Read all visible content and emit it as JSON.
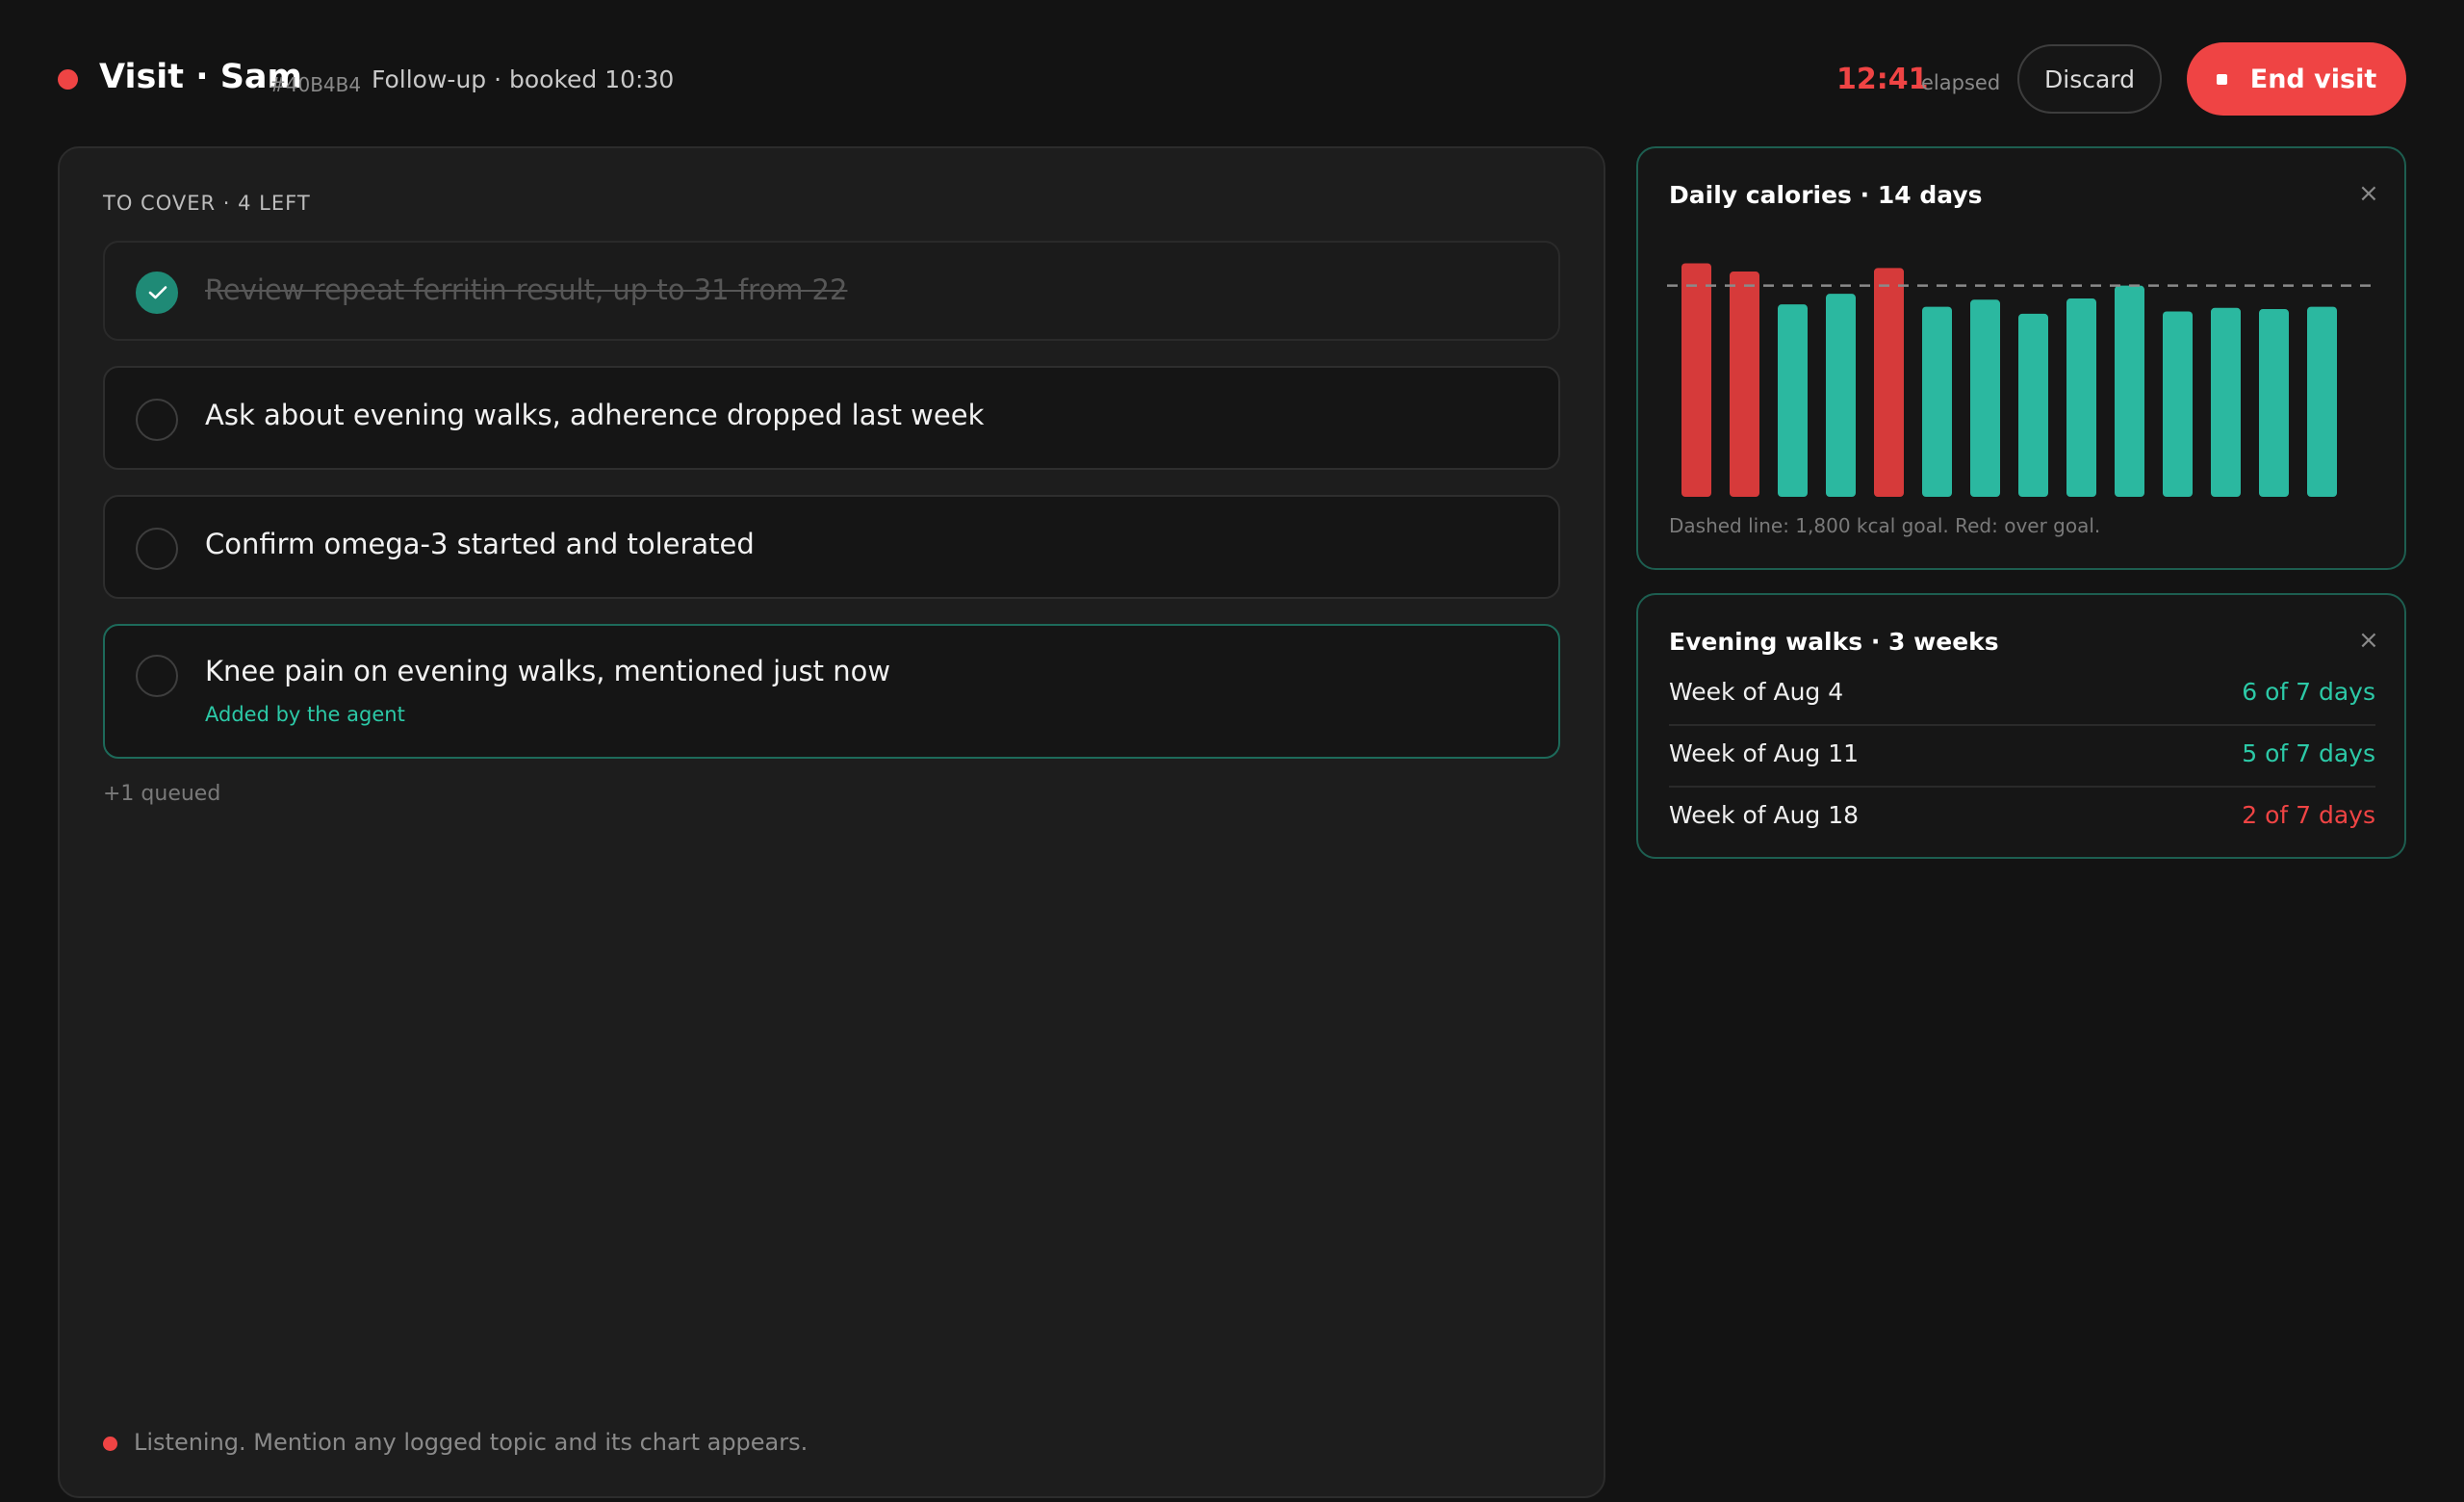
{
  "header": {
    "title": "Visit · Sam",
    "patient_id": "#40B4B4",
    "subtitle": "Follow-up · booked 10:30",
    "timer": "12:41",
    "timer_label": "elapsed",
    "discard_label": "Discard",
    "end_label": "End visit"
  },
  "checklist": {
    "heading": "TO COVER · 4 LEFT",
    "items": [
      {
        "text": "Review repeat ferritin result, up to 31 from 22",
        "done": true
      },
      {
        "text": "Ask about evening walks, adherence dropped last week",
        "done": false
      },
      {
        "text": "Confirm omega-3 started and tolerated",
        "done": false
      },
      {
        "text": "Knee pain on evening walks, mentioned just now",
        "done": false,
        "note": "Added by the agent"
      }
    ],
    "queued": "+1 queued",
    "listening": "Listening. Mention any logged topic and its chart appears."
  },
  "calories_card": {
    "title": "Daily calories · 14 days",
    "note": "Dashed line: 1,800 kcal goal. Red: over goal.",
    "close": "×"
  },
  "chart_data": {
    "type": "bar",
    "title": "Daily calories · 14 days",
    "categories": [
      "",
      "",
      "",
      "",
      "",
      "",
      "",
      "",
      "",
      "",
      "",
      "",
      "",
      ""
    ],
    "values": [
      1990,
      1920,
      1640,
      1730,
      1950,
      1620,
      1680,
      1560,
      1690,
      1800,
      1580,
      1610,
      1600,
      1620
    ],
    "goal": 1800,
    "ylim": [
      0,
      2150
    ],
    "colors": {
      "over": "#d63a3a",
      "under": "#2bb8a0",
      "goal_line": "#8a8a8a"
    }
  },
  "walks_card": {
    "title": "Evening walks · 3 weeks",
    "close": "×",
    "rows": [
      {
        "label": "Week of Aug 4",
        "value": "6 of 7 days",
        "color": "#2cc9a7"
      },
      {
        "label": "Week of Aug 11",
        "value": "5 of 7 days",
        "color": "#2cc9a7"
      },
      {
        "label": "Week of Aug 18",
        "value": "2 of 7 days",
        "color": "#f04444"
      }
    ]
  }
}
